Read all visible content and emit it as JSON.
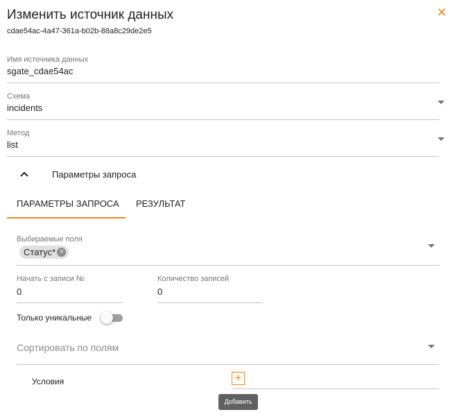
{
  "dialog": {
    "title": "Изменить источник данных",
    "id": "cdae54ac-4a47-361a-b02b-88a8c29de2e5",
    "close_icon": "close-icon"
  },
  "fields": {
    "name": {
      "label": "Имя источника данных",
      "value": "sgate_cdae54ac"
    },
    "schema": {
      "label": "Схема",
      "value": "incidents"
    },
    "method": {
      "label": "Метод",
      "value": "list"
    }
  },
  "query_section": {
    "title": "Параметры запроса",
    "toggle_icon": "chevron-up-icon"
  },
  "tabs": [
    {
      "label": "ПАРАМЕТРЫ ЗАПРОСА",
      "active": true
    },
    {
      "label": "РЕЗУЛЬТАТ",
      "active": false
    }
  ],
  "query_params": {
    "selected_fields": {
      "label": "Выбираемые поля",
      "chips": [
        "Статус*"
      ]
    },
    "start_from": {
      "label": "Начать с записи №",
      "value": "0"
    },
    "count": {
      "label": "Количество записей",
      "value": "0"
    },
    "unique_only": {
      "label": "Только уникальные",
      "on": false
    },
    "sort": {
      "placeholder": "Сортировать по полям"
    },
    "conditions": {
      "label": "Условия",
      "add_tooltip": "Добавить"
    }
  },
  "colors": {
    "accent": "#f5841f",
    "divider": "#c4c4c4",
    "muted_text": "#757575",
    "tooltip_bg": "#616161"
  }
}
